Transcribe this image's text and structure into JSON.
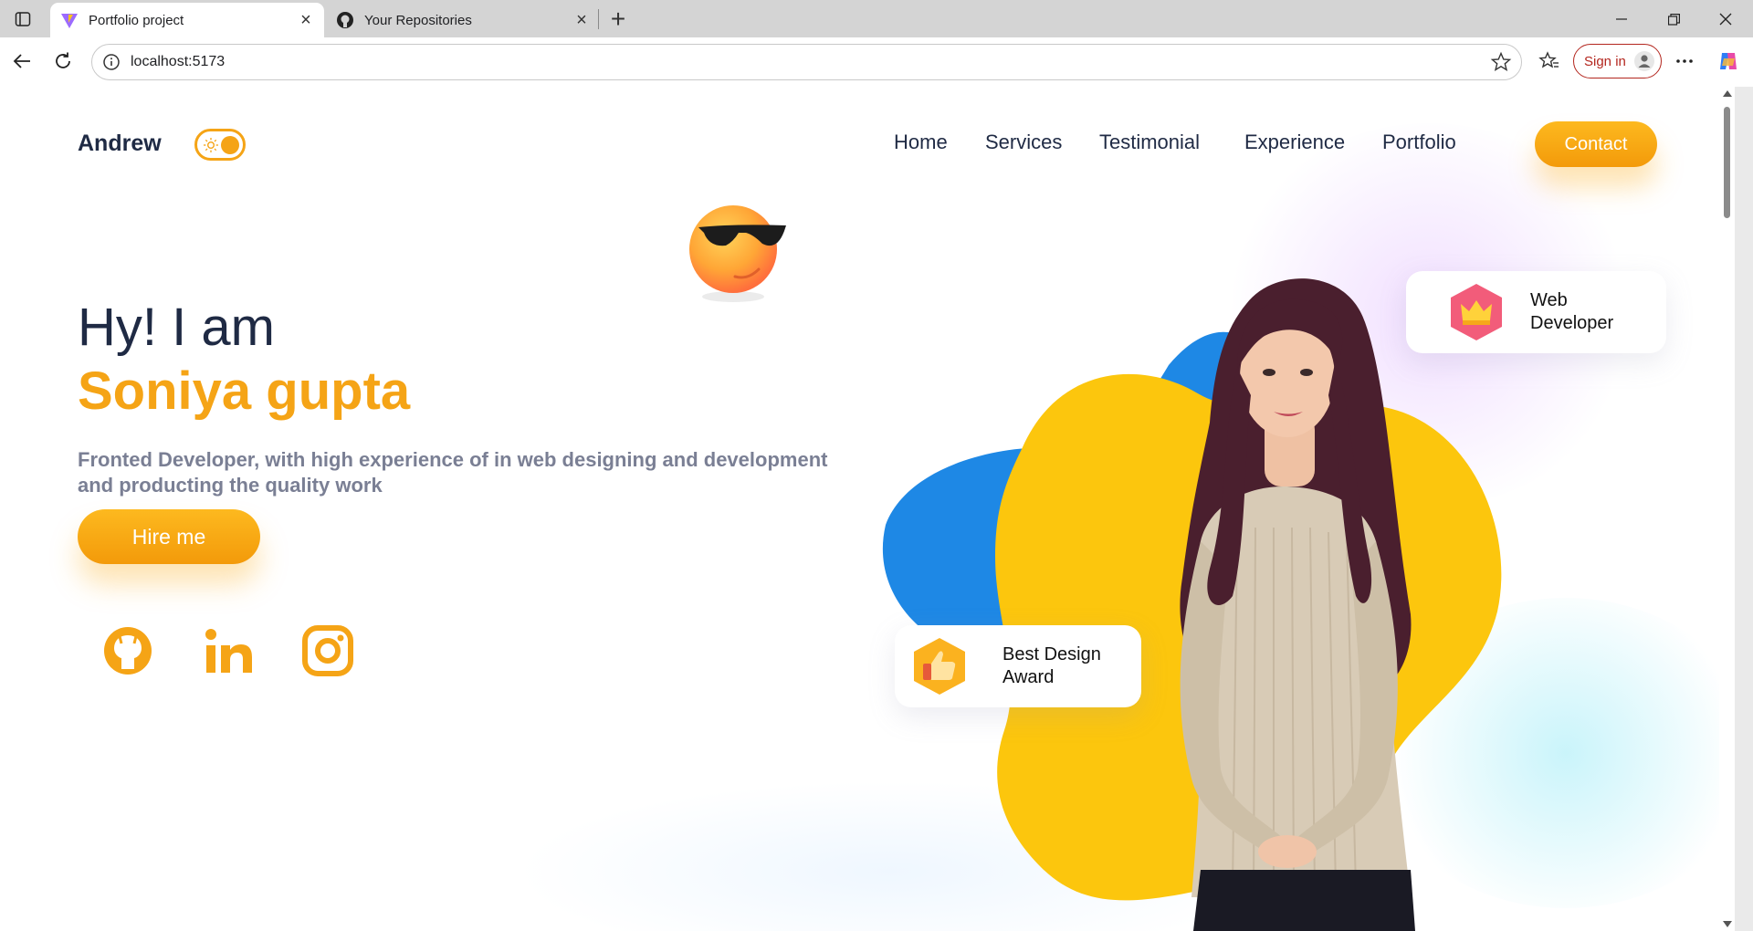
{
  "browser": {
    "tabs": [
      {
        "title": "Portfolio project",
        "icon": "vite-icon",
        "active": true
      },
      {
        "title": "Your Repositories",
        "icon": "github-icon",
        "active": false
      }
    ],
    "url": "localhost:5173",
    "signin_label": "Sign in"
  },
  "site": {
    "logo": "Andrew",
    "nav": [
      "Home",
      "Services",
      "Testimonial",
      "Experience",
      "Portfolio"
    ],
    "contact_label": "Contact",
    "theme_toggle": "light"
  },
  "hero": {
    "greeting": "Hy! I am",
    "name": "Soniya gupta",
    "description": "Fronted Developer, with high experience of in web designing and development and producting the quality work",
    "hire_label": "Hire me",
    "social": [
      "github-icon",
      "linkedin-icon",
      "instagram-icon"
    ],
    "emoji": "sunglasses-emoji-icon",
    "badges": [
      {
        "line1": "Web",
        "line2": "Developer",
        "icon": "crown-icon"
      },
      {
        "line1": "Best Design",
        "line2": "Award",
        "icon": "thumbs-up-icon"
      }
    ]
  },
  "colors": {
    "accent": "#f5a416",
    "text_dark": "#1f2a44",
    "text_muted": "#7a7f94",
    "blob_yellow": "#fcc60d",
    "blob_blue": "#1e88e5"
  }
}
